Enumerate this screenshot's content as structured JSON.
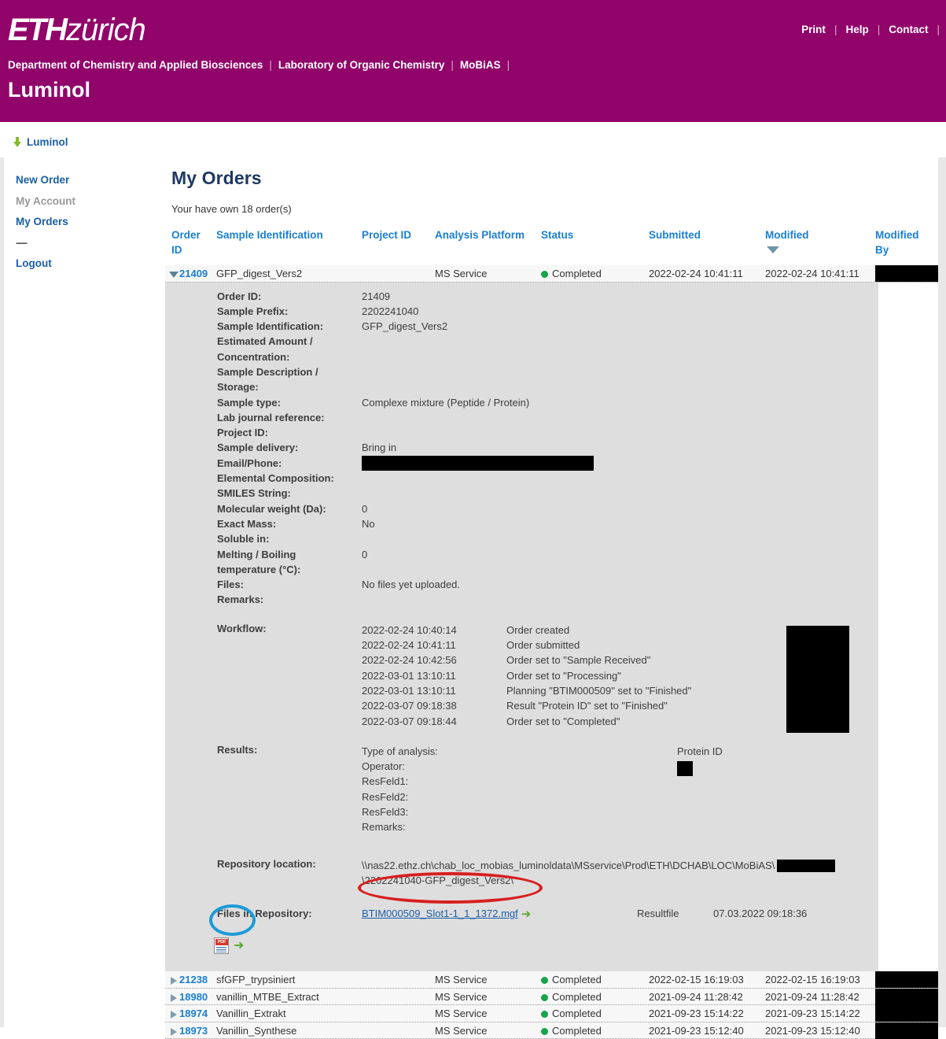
{
  "header": {
    "logo_eth": "ETH",
    "logo_zurich": "zürich",
    "top_links": [
      "Print",
      "Help",
      "Contact"
    ],
    "dept_links": [
      "Department of Chemistry and Applied Biosciences",
      "Laboratory of Organic Chemistry",
      "MoBiAS"
    ],
    "site_title": "Luminol",
    "brand_color": "#91056a"
  },
  "tab": {
    "label": "Luminol",
    "icon": "down-arrow-icon"
  },
  "sidebar": {
    "items": [
      {
        "label": "New Order",
        "state": "enabled"
      },
      {
        "label": "My Account",
        "state": "disabled"
      },
      {
        "label": "My Orders",
        "state": "enabled"
      },
      {
        "label": "----",
        "state": "separator"
      },
      {
        "label": "Logout",
        "state": "enabled"
      }
    ]
  },
  "main": {
    "page_title": "My Orders",
    "count_line": "Your have own 18 order(s)",
    "columns": {
      "order_id": "Order ID",
      "sample_identification": "Sample Identification",
      "project_id": "Project ID",
      "analysis_platform": "Analysis Platform",
      "status": "Status",
      "submitted": "Submitted",
      "modified": "Modified",
      "modified_by": "Modified By"
    },
    "sort_column": "Modified",
    "sort_direction": "descending",
    "rows": [
      {
        "order_id": "21409",
        "sample_identification": "GFP_digest_Vers2",
        "project_id": "",
        "analysis_platform": "MS Service",
        "status": "Completed",
        "submitted": "2022-02-24 10:41:11",
        "modified": "2022-02-24 10:41:11",
        "modified_by": "[redacted]",
        "expanded": true
      },
      {
        "order_id": "21238",
        "sample_identification": "sfGFP_trypsiniert",
        "project_id": "",
        "analysis_platform": "MS Service",
        "status": "Completed",
        "submitted": "2022-02-15 16:19:03",
        "modified": "2022-02-15 16:19:03",
        "modified_by": "[redacted]",
        "expanded": false
      },
      {
        "order_id": "18980",
        "sample_identification": "vanillin_MTBE_Extract",
        "project_id": "",
        "analysis_platform": "MS Service",
        "status": "Completed",
        "submitted": "2021-09-24 11:28:42",
        "modified": "2021-09-24 11:28:42",
        "modified_by": "[redacted]",
        "expanded": false
      },
      {
        "order_id": "18974",
        "sample_identification": "Vanillin_Extrakt",
        "project_id": "",
        "analysis_platform": "MS Service",
        "status": "Completed",
        "submitted": "2021-09-23 15:14:22",
        "modified": "2021-09-23 15:14:22",
        "modified_by": "[redacted]",
        "expanded": false
      },
      {
        "order_id": "18973",
        "sample_identification": "Vanillin_Synthese",
        "project_id": "",
        "analysis_platform": "MS Service",
        "status": "Completed",
        "submitted": "2021-09-23 15:12:40",
        "modified": "2021-09-23 15:12:40",
        "modified_by": "[redacted]",
        "expanded": false
      }
    ]
  },
  "detail": {
    "fields": [
      {
        "label": "Order ID:",
        "value": "21409"
      },
      {
        "label": "Sample Prefix:",
        "value": "2202241040"
      },
      {
        "label": "Sample Identification:",
        "value": "GFP_digest_Vers2"
      },
      {
        "label": "Estimated Amount /",
        "value": ""
      },
      {
        "label": "Concentration:",
        "value": ""
      },
      {
        "label": "Sample Description /",
        "value": ""
      },
      {
        "label": "Storage:",
        "value": ""
      },
      {
        "label": "Sample type:",
        "value": "Complexe mixture (Peptide / Protein)"
      },
      {
        "label": "Lab journal reference:",
        "value": ""
      },
      {
        "label": "Project ID:",
        "value": ""
      },
      {
        "label": "Sample delivery:",
        "value": "Bring in"
      },
      {
        "label": "Email/Phone:",
        "value": "",
        "redacted": true
      },
      {
        "label": "Elemental Composition:",
        "value": ""
      },
      {
        "label": "SMILES String:",
        "value": ""
      },
      {
        "label": "Molecular weight (Da):",
        "value": "0"
      },
      {
        "label": "Exact Mass:",
        "value": "No"
      },
      {
        "label": "Soluble in:",
        "value": ""
      },
      {
        "label": "Melting / Boiling",
        "value": "0"
      },
      {
        "label": "temperature (°C):",
        "value": ""
      },
      {
        "label": "Files:",
        "value": "No files yet uploaded."
      },
      {
        "label": "Remarks:",
        "value": ""
      }
    ],
    "workflow": {
      "label": "Workflow:",
      "entries": [
        {
          "date": "2022-02-24 10:40:14",
          "text": "Order created"
        },
        {
          "date": "2022-02-24 10:41:11",
          "text": "Order submitted"
        },
        {
          "date": "2022-02-24 10:42:56",
          "text": "Order set to \"Sample Received\""
        },
        {
          "date": "2022-03-01 13:10:11",
          "text": "Order set to \"Processing\""
        },
        {
          "date": "2022-03-01 13:10:11",
          "text": "Planning \"BTIM000509\" set to \"Finished\""
        },
        {
          "date": "2022-03-07 09:18:38",
          "text": "Result \"Protein ID\" set to \"Finished\""
        },
        {
          "date": "2022-03-07 09:18:44",
          "text": "Order set to \"Completed\""
        }
      ]
    },
    "results": {
      "label": "Results:",
      "entries": [
        {
          "key": "Type of analysis:",
          "value": "Protein ID"
        },
        {
          "key": "Operator:",
          "value": "",
          "redacted": true
        },
        {
          "key": "ResFeld1:",
          "value": ""
        },
        {
          "key": "ResFeld2:",
          "value": ""
        },
        {
          "key": "ResFeld3:",
          "value": ""
        },
        {
          "key": "Remarks:",
          "value": ""
        }
      ]
    },
    "repository": {
      "label": "Repository location:",
      "line1": "\\\\nas22.ethz.ch\\chab_loc_mobias_luminoldata\\MSservice\\Prod\\ETH\\DCHAB\\LOC\\MoBiAS\\",
      "line2": "\\2202241040-GFP_digest_Vers2\\"
    },
    "files_in_repository": {
      "label": "Files in Repository:",
      "file_name": "BTIM000509_Slot1-1_1_1372.mgf",
      "file_type": "Resultfile",
      "file_date": "07.03.2022 09:18:36",
      "pdf_icon": "pdf-icon"
    }
  },
  "annotations": {
    "red_ellipse_target": "BTIM000509_Slot1-1_1_1372.mgf",
    "blue_ellipse_target": "pdf-icon",
    "red_color": "#d81f1f",
    "blue_color": "#1a9bd7"
  }
}
